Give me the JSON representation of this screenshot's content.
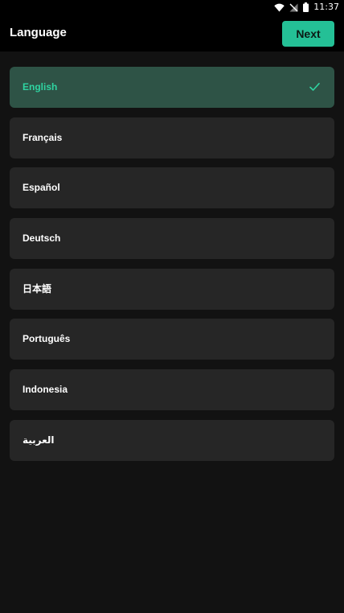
{
  "status_bar": {
    "time": "11:37",
    "icons": [
      "wifi-icon",
      "no-signal-icon",
      "battery-icon"
    ]
  },
  "header": {
    "title": "Language",
    "next_label": "Next"
  },
  "colors": {
    "accent": "#24c096",
    "selected_bg": "#2e5346",
    "item_bg": "#262626",
    "background": "#121212"
  },
  "languages": [
    {
      "label": "English",
      "selected": true
    },
    {
      "label": "Français",
      "selected": false
    },
    {
      "label": "Español",
      "selected": false
    },
    {
      "label": "Deutsch",
      "selected": false
    },
    {
      "label": "日本語",
      "selected": false
    },
    {
      "label": "Português",
      "selected": false
    },
    {
      "label": "Indonesia",
      "selected": false
    },
    {
      "label": "العربية",
      "selected": false
    }
  ]
}
